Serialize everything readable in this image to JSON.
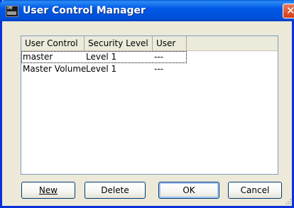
{
  "window": {
    "title": "User Control Manager",
    "app_icon": "dme-app-icon",
    "app_icon_text": "DME"
  },
  "list": {
    "columns": [
      "User Control",
      "Security Level",
      "User"
    ],
    "rows": [
      {
        "user_control": "master",
        "security_level": "Level 1",
        "user": "---"
      },
      {
        "user_control": "Master Volume",
        "security_level": "Level 1",
        "user": "---"
      }
    ]
  },
  "buttons": {
    "new": "New",
    "delete": "Delete",
    "ok": "OK",
    "cancel": "Cancel"
  },
  "colors": {
    "titlebar": "#0058e6",
    "window_bg": "#ece9d8",
    "close": "#d43c16"
  }
}
